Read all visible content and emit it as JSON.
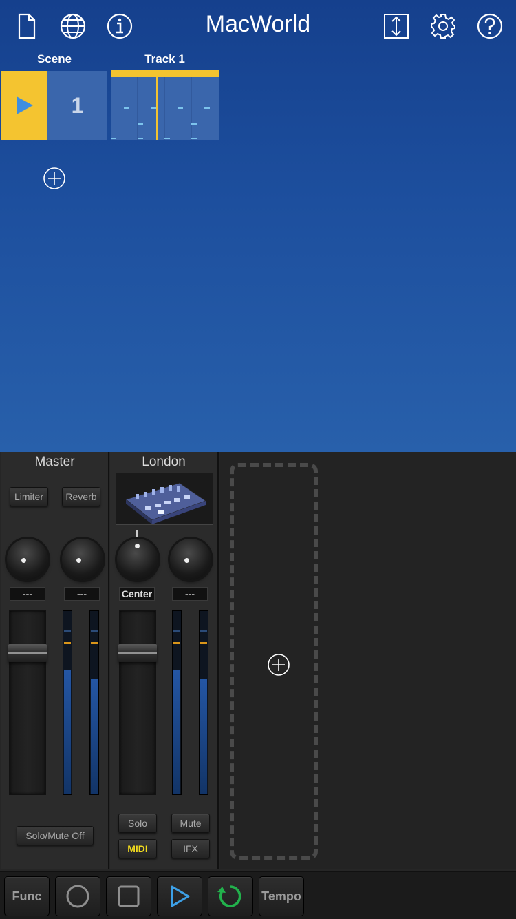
{
  "header": {
    "title": "MacWorld",
    "icons": [
      "document-icon",
      "globe-icon",
      "info-icon",
      "resize-vertical-icon",
      "gear-icon",
      "help-icon"
    ]
  },
  "arrangement": {
    "scene_header": "Scene",
    "track_header": "Track 1",
    "scene_number": "1",
    "accent_color": "#f4c430"
  },
  "mixer": {
    "master": {
      "title": "Master",
      "insert_left": "Limiter",
      "insert_right": "Reverb",
      "readout_left": "---",
      "readout_right": "---",
      "solo_mute_label": "Solo/Mute Off",
      "meter_left_level": 0.68,
      "meter_right_level": 0.63
    },
    "london": {
      "title": "London",
      "pan_readout": "Center",
      "send_readout": "---",
      "solo_label": "Solo",
      "mute_label": "Mute",
      "midi_label": "MIDI",
      "ifx_label": "IFX",
      "meter_left_level": 0.68,
      "meter_right_level": 0.63
    }
  },
  "transport": {
    "func_label": "Func",
    "tempo_label": "Tempo",
    "loop_color": "#22b14c",
    "play_color": "#3da0e6"
  }
}
